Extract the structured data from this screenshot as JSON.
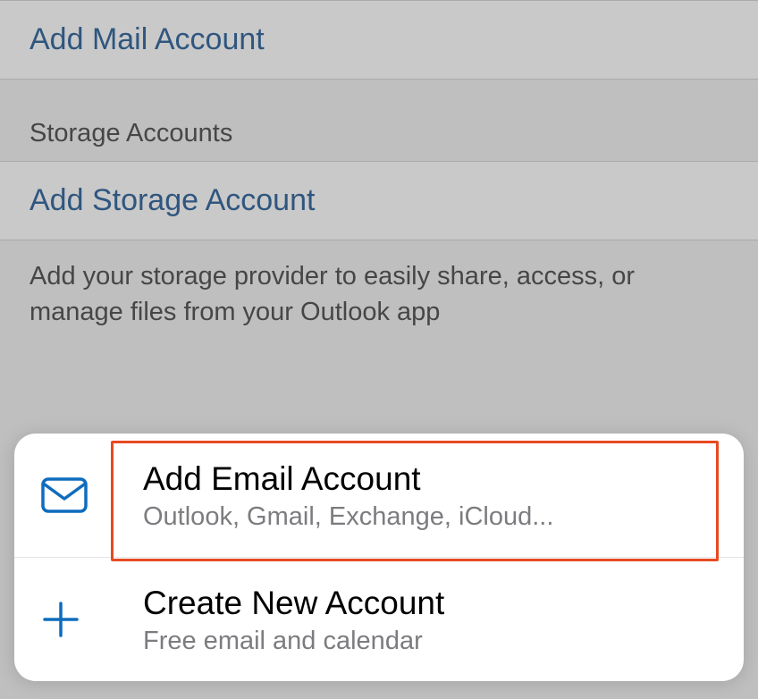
{
  "list": {
    "add_mail_label": "Add Mail Account",
    "storage_section_header": "Storage Accounts",
    "add_storage_label": "Add Storage Account",
    "storage_footer": "Add your storage provider to easily share, access, or manage files from your Outlook app"
  },
  "sheet": {
    "items": [
      {
        "title": "Add Email Account",
        "subtitle": "Outlook, Gmail, Exchange, iCloud..."
      },
      {
        "title": "Create New Account",
        "subtitle": "Free email and calendar"
      }
    ]
  },
  "colors": {
    "link": "#1a5491",
    "accent": "#0f6cbd",
    "highlight": "#e74a21"
  }
}
